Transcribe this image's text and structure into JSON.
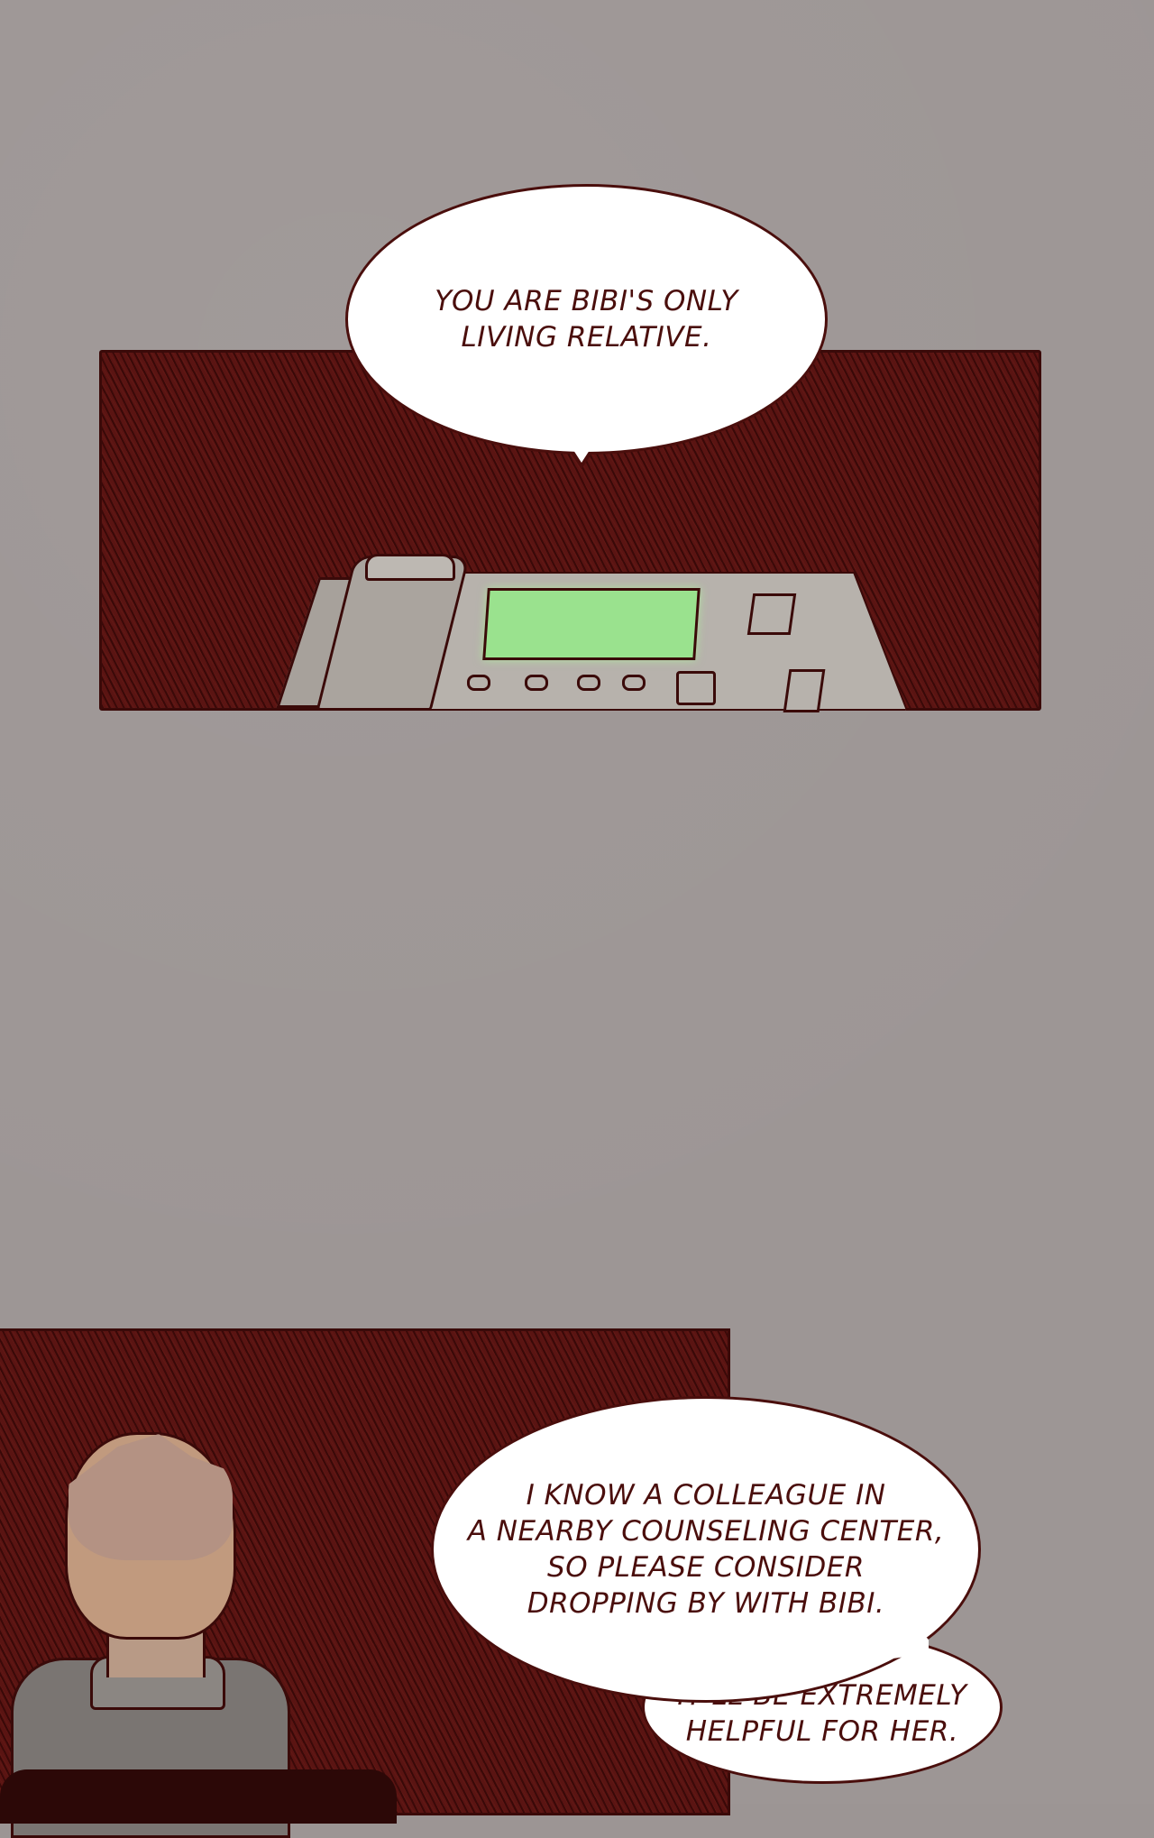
{
  "speech": {
    "bubble_1": "YOU ARE BIBI'S ONLY\nLIVING RELATIVE.",
    "bubble_2": "I KNOW A COLLEAGUE IN\nA NEARBY COUNSELING CENTER,\nSO PLEASE CONSIDER\nDROPPING BY WITH BIBI.",
    "bubble_3": "IT'LL BE EXTREMELY\nHELPFUL FOR HER."
  },
  "colors": {
    "background": "#9d9695",
    "panel": "#5a1412",
    "ink": "#4a0e0c",
    "phone_screen": "#9ae28e"
  },
  "icons": [
    "desk-phone-icon",
    "man-from-behind-icon"
  ]
}
